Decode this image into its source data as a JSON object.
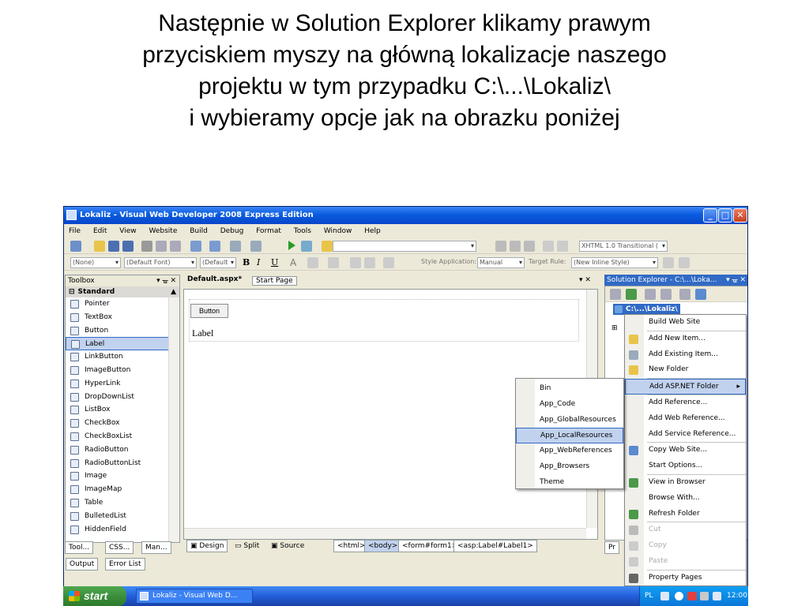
{
  "slide": {
    "title_lines": [
      "Następnie w Solution Explorer klikamy prawym",
      "przyciskiem myszy na główną lokalizacje naszego",
      "projektu w tym przypadku C:\\...\\Lokaliz\\",
      "i wybieramy opcje jak na obrazku poniżej"
    ]
  },
  "window": {
    "title": "Lokaliz - Visual Web Developer 2008 Express Edition",
    "menu": [
      "File",
      "Edit",
      "View",
      "Website",
      "Build",
      "Debug",
      "Format",
      "Tools",
      "Window",
      "Help"
    ],
    "toolbar2": {
      "combo_none": "(None)",
      "combo_font": "(Default Font)",
      "combo_size": "(Default",
      "style_app_label": "Style Application:",
      "style_app_value": "Manual",
      "target_rule_label": "Target Rule:",
      "target_rule_value": "(New Inline Style)"
    },
    "doctype_combo": "XHTML 1.0 Transitional (",
    "toolbox": {
      "title": "Toolbox",
      "category": "Standard",
      "items": [
        "Pointer",
        "TextBox",
        "Button",
        "Label",
        "LinkButton",
        "ImageButton",
        "HyperLink",
        "DropDownList",
        "ListBox",
        "CheckBox",
        "CheckBoxList",
        "RadioButton",
        "RadioButtonList",
        "Image",
        "ImageMap",
        "Table",
        "BulletedList",
        "HiddenField"
      ],
      "selected": "Label",
      "bottom_tabs": [
        "Tool...",
        "CSS...",
        "Man..."
      ]
    },
    "document": {
      "tabs": [
        "Default.aspx*",
        "Start Page"
      ],
      "button_text": "Button",
      "label_text": "Label",
      "view_tabs": [
        "Design",
        "Split",
        "Source"
      ],
      "tag_path": [
        "<html>",
        "<body>",
        "<form#form1>",
        "<asp:Label#Label1>"
      ]
    },
    "output_tabs": [
      "Output",
      "Error List"
    ],
    "solution_explorer": {
      "title": "Solution Explorer - C:\\...\\Loka...",
      "root": "C:\\...\\Lokaliz\\",
      "bottom_tab": "Pr"
    },
    "context_menu": [
      {
        "label": "Build Web Site",
        "enabled": true
      },
      {
        "label": "Add New Item...",
        "enabled": true
      },
      {
        "label": "Add Existing Item...",
        "enabled": true
      },
      {
        "label": "New Folder",
        "enabled": true
      },
      {
        "label": "Add ASP.NET Folder",
        "enabled": true,
        "highlighted": true,
        "submenu": true
      },
      {
        "label": "Add Reference...",
        "enabled": true
      },
      {
        "label": "Add Web Reference...",
        "enabled": true
      },
      {
        "label": "Add Service Reference...",
        "enabled": true
      },
      {
        "label": "Copy Web Site...",
        "enabled": true
      },
      {
        "label": "Start Options...",
        "enabled": true
      },
      {
        "label": "View in Browser",
        "enabled": true
      },
      {
        "label": "Browse With...",
        "enabled": true
      },
      {
        "label": "Refresh Folder",
        "enabled": true
      },
      {
        "label": "Cut",
        "enabled": false
      },
      {
        "label": "Copy",
        "enabled": false
      },
      {
        "label": "Paste",
        "enabled": false
      },
      {
        "label": "Property Pages",
        "enabled": true
      }
    ],
    "submenu": {
      "items": [
        "Bin",
        "App_Code",
        "App_GlobalResources",
        "App_LocalResources",
        "App_WebReferences",
        "App_Browsers",
        "Theme"
      ],
      "highlighted": "App_LocalResources"
    }
  },
  "taskbar": {
    "start_label": "start",
    "task_label": "Lokaliz - Visual Web D...",
    "lang": "PL",
    "clock": "12:00"
  }
}
